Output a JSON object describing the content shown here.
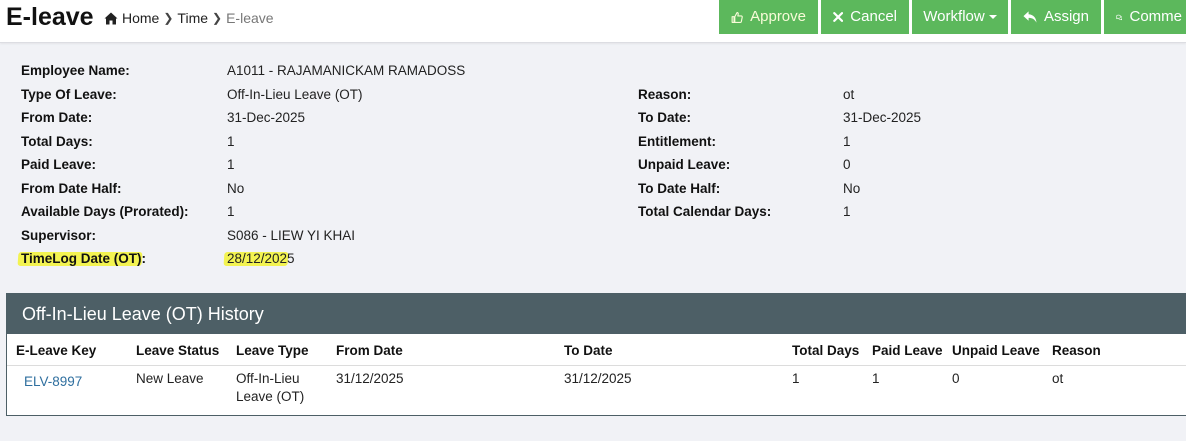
{
  "header": {
    "title": "E-leave",
    "breadcrumb": [
      {
        "label": "Home",
        "icon": "home-icon"
      },
      {
        "label": "Time"
      },
      {
        "label": "E-leave"
      }
    ]
  },
  "toolbar": {
    "approve_label": "Approve",
    "cancel_label": "Cancel",
    "workflow_label": "Workflow",
    "assign_label": "Assign",
    "comment_label": "Comme",
    "button_color": "#5cb85c"
  },
  "details": {
    "employee_name": {
      "label": "Employee Name:",
      "value": "A1011 - RAJAMANICKAM RAMADOSS"
    },
    "type_of_leave": {
      "label": "Type Of Leave:",
      "value": "Off-In-Lieu Leave (OT)"
    },
    "from_date": {
      "label": "From Date:",
      "value": "31-Dec-2025"
    },
    "total_days": {
      "label": "Total Days:",
      "value": "1"
    },
    "paid_leave": {
      "label": "Paid Leave:",
      "value": "1"
    },
    "from_date_half": {
      "label": "From Date Half:",
      "value": "No"
    },
    "available_days": {
      "label": "Available Days (Prorated):",
      "value": "1"
    },
    "supervisor": {
      "label": "Supervisor:",
      "value": "S086 - LIEW YI KHAI"
    },
    "timelog_date": {
      "label": "TimeLog Date (OT):",
      "value": "28/12/2025"
    },
    "reason": {
      "label": "Reason:",
      "value": "ot"
    },
    "to_date": {
      "label": "To Date:",
      "value": "31-Dec-2025"
    },
    "entitlement": {
      "label": "Entitlement:",
      "value": "1"
    },
    "unpaid_leave": {
      "label": "Unpaid Leave:",
      "value": "0"
    },
    "to_date_half": {
      "label": "To Date Half:",
      "value": "No"
    },
    "total_calendar_days": {
      "label": "Total Calendar Days:",
      "value": "1"
    }
  },
  "highlight_color": "#f3f31a",
  "history": {
    "title": "Off-In-Lieu Leave (OT) History",
    "header_color": "#4d5f66",
    "columns": [
      "E-Leave Key",
      "Leave Status",
      "Leave Type",
      "From Date",
      "To Date",
      "Total Days",
      "Paid Leave",
      "Unpaid Leave",
      "Reason"
    ],
    "rows": [
      {
        "key": "ELV-8997",
        "status": "New Leave",
        "type": "Off-In-Lieu Leave (OT)",
        "from": "31/12/2025",
        "to": "31/12/2025",
        "total_days": "1",
        "paid_leave": "1",
        "unpaid_leave": "0",
        "reason": "ot"
      }
    ]
  }
}
